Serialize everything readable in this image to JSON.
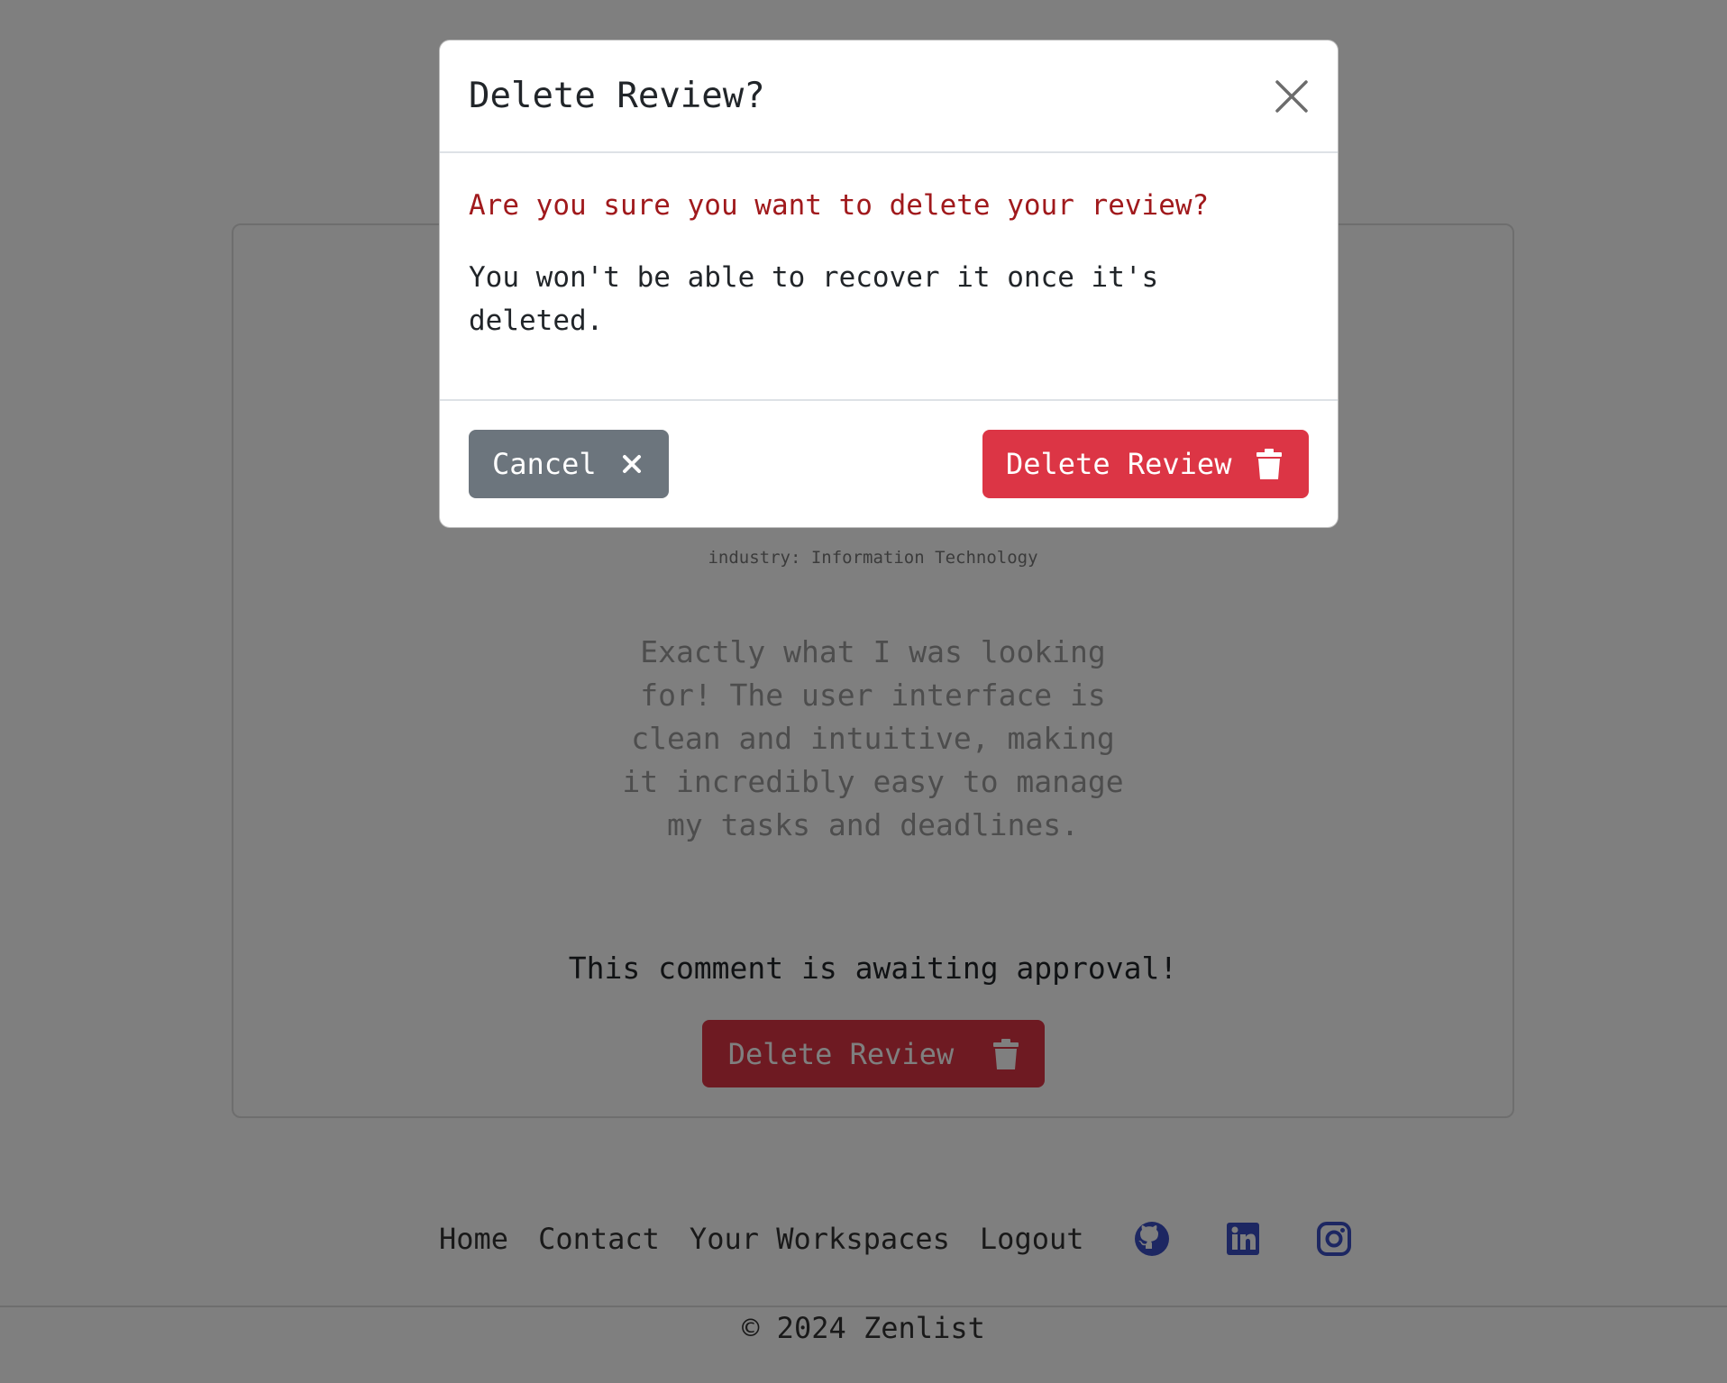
{
  "review_card": {
    "industry": "industry: Information Technology",
    "review_text": "Exactly what I was looking for! The user interface is clean and intuitive, making it incredibly easy to manage my tasks and deadlines.",
    "awaiting": "This comment is awaiting approval!",
    "delete_label": "Delete Review"
  },
  "footer": {
    "nav": [
      "Home",
      "Contact",
      "Your Workspaces",
      "Logout"
    ],
    "social_icons": [
      "github-icon",
      "linkedin-icon",
      "instagram-icon"
    ],
    "copyright": "© 2024 Zenlist"
  },
  "modal": {
    "title": "Delete Review?",
    "warning": "Are you sure you want to delete your review?",
    "body": "You won't be able to recover it once it's deleted.",
    "cancel_label": "Cancel",
    "delete_label": "Delete Review"
  },
  "colors": {
    "danger": "#dc3545",
    "secondary": "#6c757d",
    "warning_text": "#a0191c",
    "social": "#3b4fc4"
  }
}
